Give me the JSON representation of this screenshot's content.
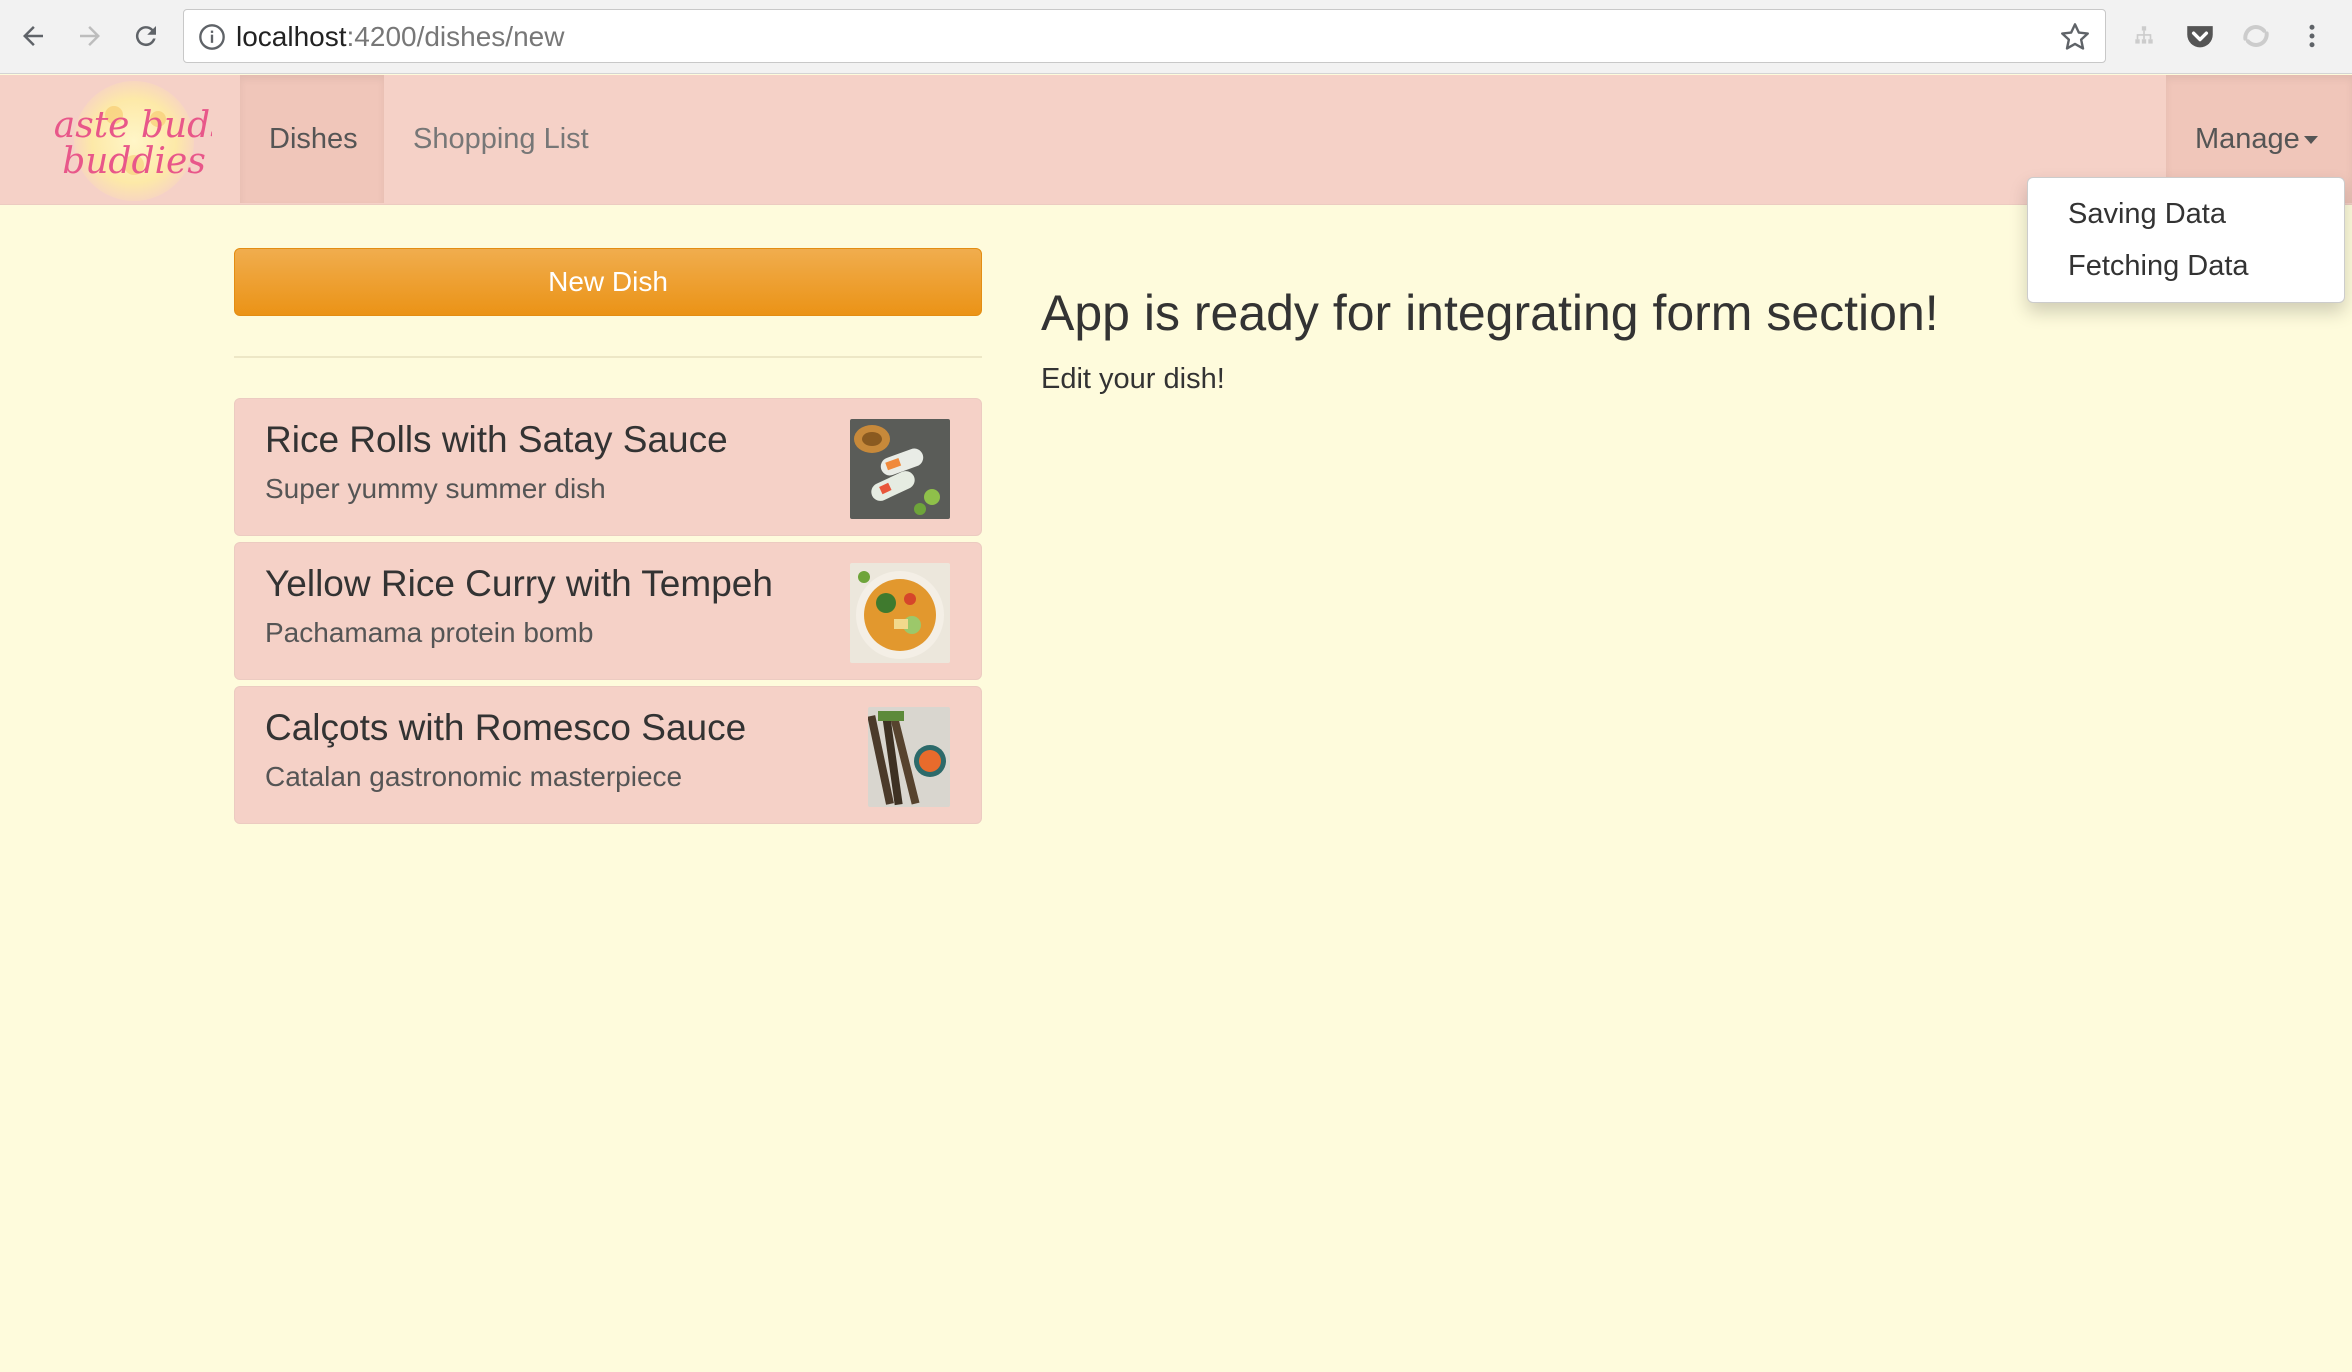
{
  "browser": {
    "url_host": "localhost",
    "url_path": ":4200/dishes/new"
  },
  "navbar": {
    "logo_line1": "taste buds",
    "logo_line2": "buddies",
    "items": [
      {
        "label": "Dishes",
        "active": true
      },
      {
        "label": "Shopping List",
        "active": false
      }
    ],
    "manage_label": "Manage"
  },
  "dropdown": {
    "items": [
      {
        "label": "Saving Data"
      },
      {
        "label": "Fetching Data"
      }
    ]
  },
  "sidebar": {
    "new_button_label": "New Dish",
    "dishes": [
      {
        "title": "Rice Rolls with Satay Sauce",
        "description": "Super yummy summer dish"
      },
      {
        "title": "Yellow Rice Curry with Tempeh",
        "description": "Pachamama protein bomb"
      },
      {
        "title": "Calçots with Romesco Sauce",
        "description": "Catalan gastronomic masterpiece"
      }
    ]
  },
  "main": {
    "headline": "App is ready for integrating form section!",
    "subline": "Edit your dish!"
  },
  "colors": {
    "page_bg": "#fefbdc",
    "navbar_bg": "#f5d1c7",
    "button_orange": "#eb9316",
    "logo_pink": "#e8578a"
  }
}
